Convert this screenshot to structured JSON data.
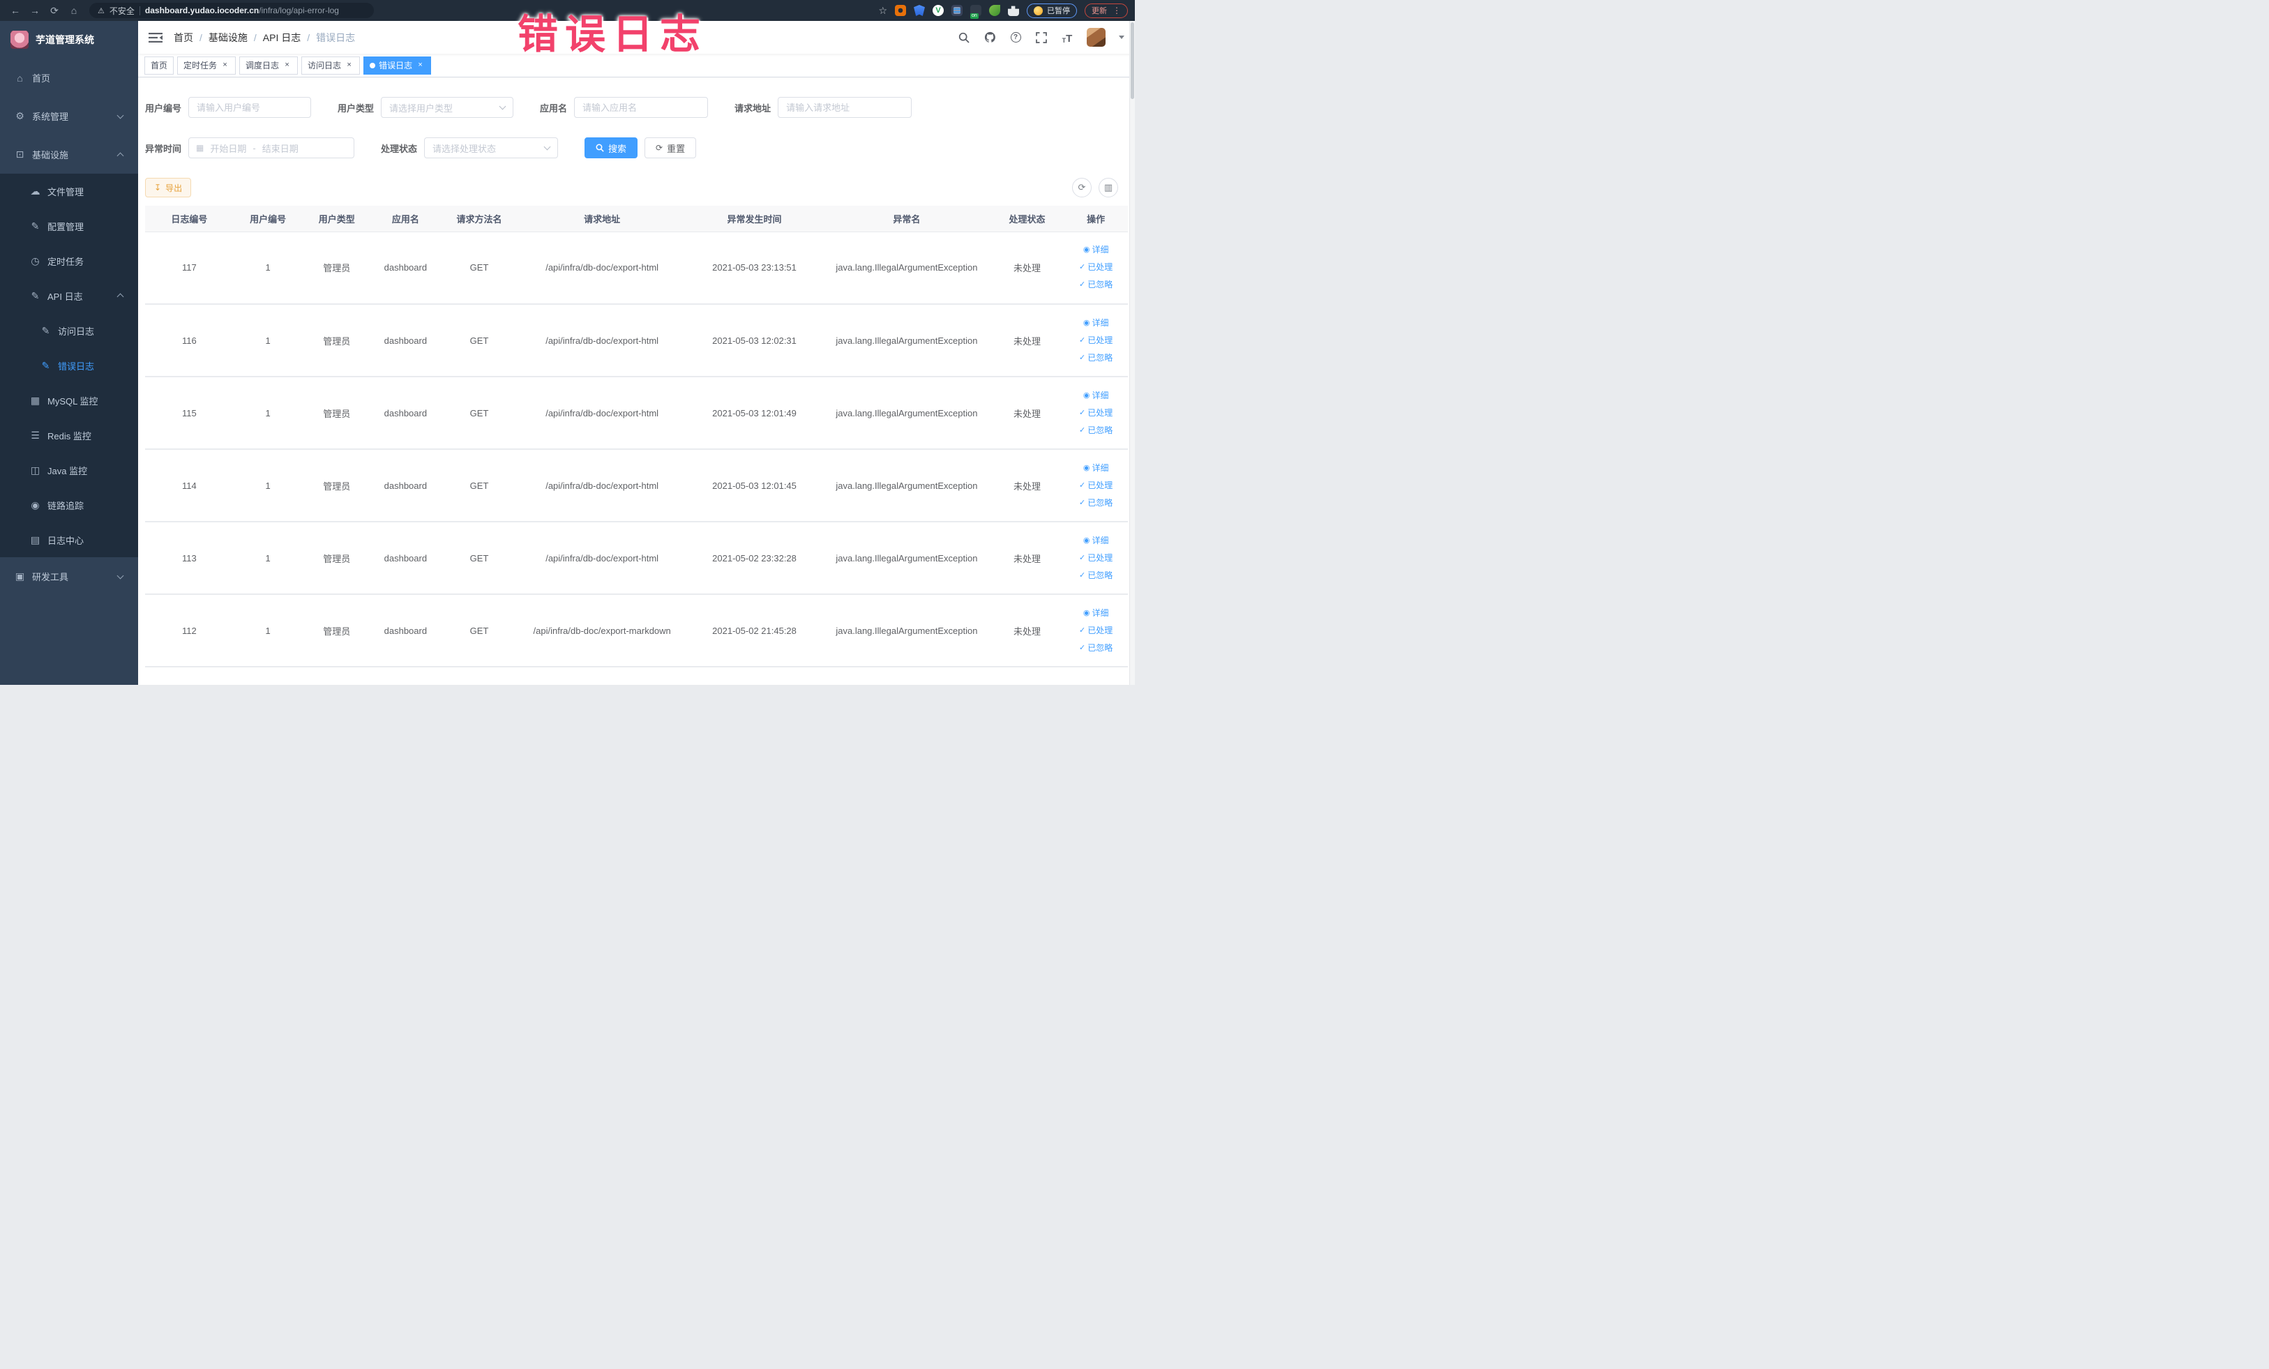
{
  "browser": {
    "security_label": "不安全",
    "url_domain": "dashboard.yudao.iocoder.cn",
    "url_path": "/infra/log/api-error-log",
    "ext_badge_on": "on",
    "ext_v_logo": "V",
    "paused_label": "已暂停",
    "update_label": "更新"
  },
  "annotation": {
    "text": "错误日志",
    "color": "#f2416b"
  },
  "sidebar": {
    "title": "芋道管理系统",
    "items": [
      {
        "label": "首页",
        "icon": "home-icon",
        "glyph": "⌂",
        "level": 1
      },
      {
        "label": "系统管理",
        "icon": "system-manage-icon",
        "glyph": "⚙",
        "level": 1,
        "arrow": "down"
      },
      {
        "label": "基础设施",
        "icon": "infrastructure-icon",
        "glyph": "⊡",
        "level": 1,
        "arrow": "up"
      },
      {
        "label": "文件管理",
        "icon": "file-manage-icon",
        "glyph": "☁",
        "level": 2
      },
      {
        "label": "配置管理",
        "icon": "config-manage-icon",
        "glyph": "✎",
        "level": 2
      },
      {
        "label": "定时任务",
        "icon": "scheduled-task-icon",
        "glyph": "◷",
        "level": 2
      },
      {
        "label": "API 日志",
        "icon": "api-log-icon",
        "glyph": "✎",
        "level": 2,
        "arrow": "up"
      },
      {
        "label": "访问日志",
        "icon": "access-log-icon",
        "glyph": "✎",
        "level": 3
      },
      {
        "label": "错误日志",
        "icon": "error-log-icon",
        "glyph": "✎",
        "level": 3,
        "active": true
      },
      {
        "label": "MySQL 监控",
        "icon": "mysql-monitor-icon",
        "glyph": "▦",
        "level": 2
      },
      {
        "label": "Redis 监控",
        "icon": "redis-monitor-icon",
        "glyph": "☰",
        "level": 2
      },
      {
        "label": "Java 监控",
        "icon": "java-monitor-icon",
        "glyph": "◫",
        "level": 2
      },
      {
        "label": "链路追踪",
        "icon": "trace-icon",
        "glyph": "◉",
        "level": 2
      },
      {
        "label": "日志中心",
        "icon": "log-center-icon",
        "glyph": "▤",
        "level": 2
      },
      {
        "label": "研发工具",
        "icon": "devtools-icon",
        "glyph": "▣",
        "level": 1,
        "arrow": "down"
      }
    ]
  },
  "navbar": {
    "breadcrumb": [
      "首页",
      "基础设施",
      "API 日志",
      "错误日志"
    ],
    "separator": "/"
  },
  "tabs": [
    {
      "label": "首页",
      "closable": false,
      "active": false
    },
    {
      "label": "定时任务",
      "closable": true,
      "active": false
    },
    {
      "label": "调度日志",
      "closable": true,
      "active": false
    },
    {
      "label": "访问日志",
      "closable": true,
      "active": false
    },
    {
      "label": "错误日志",
      "closable": true,
      "active": true
    }
  ],
  "filters": {
    "user_id": {
      "label": "用户编号",
      "placeholder": "请输入用户编号"
    },
    "user_type": {
      "label": "用户类型",
      "placeholder": "请选择用户类型"
    },
    "app_name": {
      "label": "应用名",
      "placeholder": "请输入应用名"
    },
    "request_url": {
      "label": "请求地址",
      "placeholder": "请输入请求地址"
    },
    "exception_time": {
      "label": "异常时间",
      "start_placeholder": "开始日期",
      "range_separator": "-",
      "end_placeholder": "结束日期"
    },
    "process_status": {
      "label": "处理状态",
      "placeholder": "请选择处理状态"
    },
    "search_label": "搜索",
    "reset_label": "重置"
  },
  "toolbar": {
    "export_label": "导出"
  },
  "table": {
    "columns": [
      "日志编号",
      "用户编号",
      "用户类型",
      "应用名",
      "请求方法名",
      "请求地址",
      "异常发生时间",
      "异常名",
      "处理状态",
      "操作"
    ],
    "action_labels": [
      "详细",
      "已处理",
      "已忽略"
    ],
    "action_icons": [
      "eye",
      "check",
      "check"
    ],
    "rows": [
      {
        "id": "117",
        "user_id": "1",
        "user_type": "管理员",
        "app": "dashboard",
        "method": "GET",
        "url": "/api/infra/db-doc/export-html",
        "time": "2021-05-03 23:13:51",
        "exception": "java.lang.IllegalArgumentException",
        "status": "未处理"
      },
      {
        "id": "116",
        "user_id": "1",
        "user_type": "管理员",
        "app": "dashboard",
        "method": "GET",
        "url": "/api/infra/db-doc/export-html",
        "time": "2021-05-03 12:02:31",
        "exception": "java.lang.IllegalArgumentException",
        "status": "未处理"
      },
      {
        "id": "115",
        "user_id": "1",
        "user_type": "管理员",
        "app": "dashboard",
        "method": "GET",
        "url": "/api/infra/db-doc/export-html",
        "time": "2021-05-03 12:01:49",
        "exception": "java.lang.IllegalArgumentException",
        "status": "未处理"
      },
      {
        "id": "114",
        "user_id": "1",
        "user_type": "管理员",
        "app": "dashboard",
        "method": "GET",
        "url": "/api/infra/db-doc/export-html",
        "time": "2021-05-03 12:01:45",
        "exception": "java.lang.IllegalArgumentException",
        "status": "未处理"
      },
      {
        "id": "113",
        "user_id": "1",
        "user_type": "管理员",
        "app": "dashboard",
        "method": "GET",
        "url": "/api/infra/db-doc/export-html",
        "time": "2021-05-02 23:32:28",
        "exception": "java.lang.IllegalArgumentException",
        "status": "未处理"
      },
      {
        "id": "112",
        "user_id": "1",
        "user_type": "管理员",
        "app": "dashboard",
        "method": "GET",
        "url": "/api/infra/db-doc/export-markdown",
        "time": "2021-05-02 21:45:28",
        "exception": "java.lang.IllegalArgumentException",
        "status": "未处理"
      }
    ]
  },
  "icons": {
    "back": "←",
    "forward": "→",
    "reload": "⟳",
    "home": "⌂",
    "warning": "⚠",
    "star": "☆",
    "menu_dots": "⋮",
    "close": "×",
    "check": "✓",
    "eye": "◉",
    "refresh": "⟳",
    "columns": "▥",
    "download": "↧",
    "calendar": "▦",
    "question": "?",
    "font_size": "T"
  },
  "colors": {
    "accent": "#409eff",
    "warning": "#e6a23c",
    "sidebar_bg": "#304156",
    "submenu_bg": "#1f2d3d"
  }
}
